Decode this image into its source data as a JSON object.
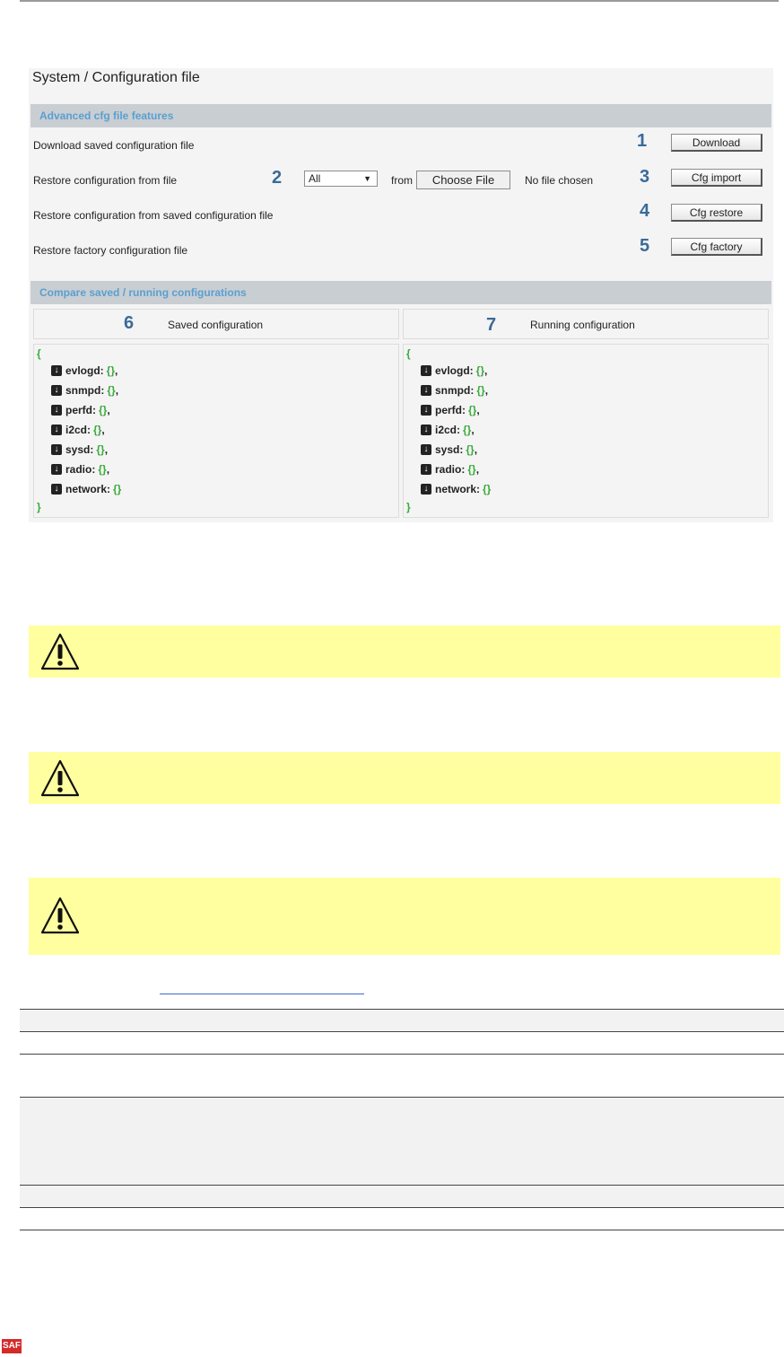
{
  "panel": {
    "title": "System / Configuration file",
    "section_advanced": "Advanced cfg file features",
    "rows": [
      {
        "label": "Download saved configuration file",
        "number": "1",
        "button": "Download"
      },
      {
        "label": "Restore configuration from file",
        "number": "3",
        "button": "Cfg import"
      },
      {
        "label": "Restore configuration from saved configuration file",
        "number": "4",
        "button": "Cfg restore"
      },
      {
        "label": "Restore factory configuration file",
        "number": "5",
        "button": "Cfg factory"
      }
    ],
    "restore_file": {
      "number": "2",
      "select_value": "All",
      "from_label": "from",
      "choose_button": "Choose File",
      "file_status": "No file chosen"
    },
    "section_compare": "Compare saved / running configurations",
    "saved": {
      "number": "6",
      "label": "Saved configuration",
      "open_brace": "{",
      "close_brace": "}",
      "items": [
        {
          "key": "evlogd:",
          "value": "{}",
          "sep": ","
        },
        {
          "key": "snmpd:",
          "value": "{}",
          "sep": ","
        },
        {
          "key": "perfd:",
          "value": "{}",
          "sep": ","
        },
        {
          "key": "i2cd:",
          "value": "{}",
          "sep": ","
        },
        {
          "key": "sysd:",
          "value": "{}",
          "sep": ","
        },
        {
          "key": "radio:",
          "value": "{}",
          "sep": ","
        },
        {
          "key": "network:",
          "value": "{}",
          "sep": ""
        }
      ]
    },
    "running": {
      "number": "7",
      "label": "Running configuration",
      "open_brace": "{",
      "close_brace": "}",
      "items": [
        {
          "key": "evlogd:",
          "value": "{}",
          "sep": ","
        },
        {
          "key": "snmpd:",
          "value": "{}",
          "sep": ","
        },
        {
          "key": "perfd:",
          "value": "{}",
          "sep": ","
        },
        {
          "key": "i2cd:",
          "value": "{}",
          "sep": ","
        },
        {
          "key": "sysd:",
          "value": "{}",
          "sep": ","
        },
        {
          "key": "radio:",
          "value": "{}",
          "sep": ","
        },
        {
          "key": "network:",
          "value": "{}",
          "sep": ""
        }
      ]
    }
  },
  "icons": {
    "warning": "warning-triangle-icon",
    "download": "arrow-down-icon"
  },
  "colors": {
    "section_bar": "#c9ced3",
    "section_text": "#5a9fd0",
    "step_number": "#3a6a98",
    "json_brace": "#3aaa3a",
    "warning_bg": "#ffffa0"
  },
  "footer": {
    "logo_text": "SAF"
  }
}
